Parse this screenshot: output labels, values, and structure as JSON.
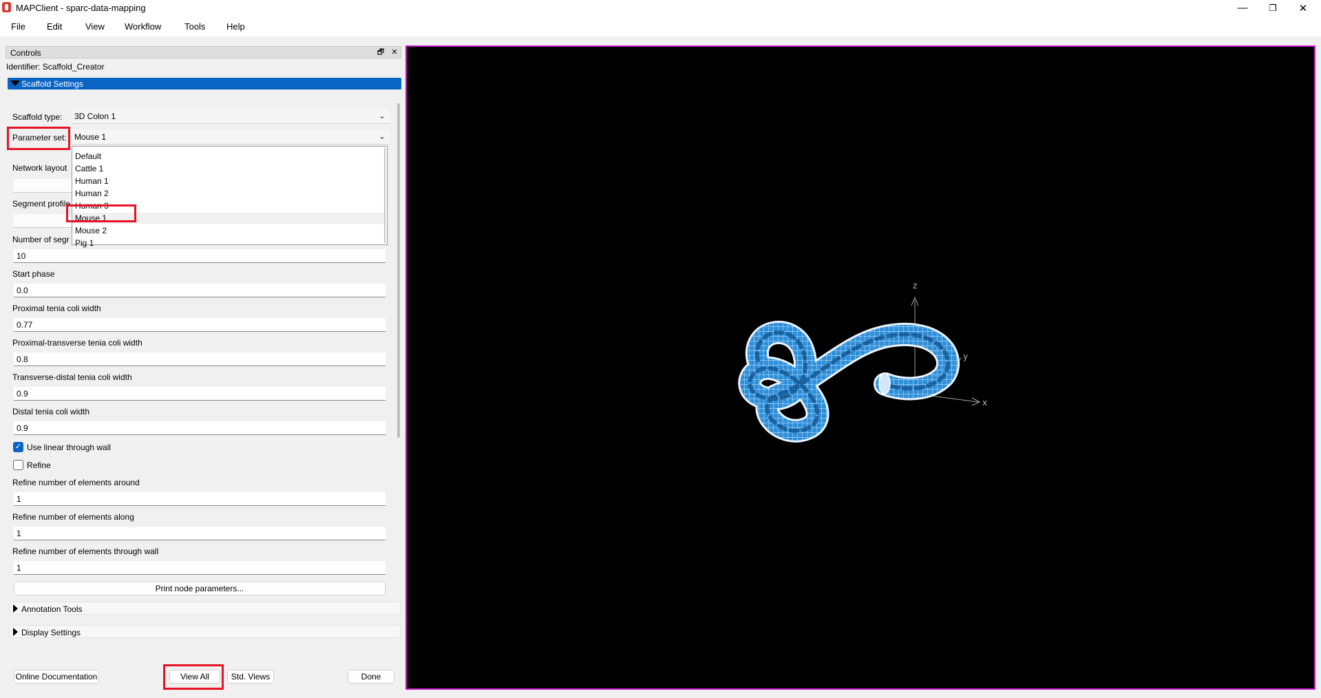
{
  "window": {
    "title": "MAPClient - sparc-data-mapping",
    "controls": {
      "minimize": "—",
      "restore": "❐",
      "close": "✕"
    }
  },
  "menubar": [
    "File",
    "Edit",
    "View",
    "Workflow",
    "Tools",
    "Help"
  ],
  "dock": {
    "title": "Controls",
    "float_icon": "🗗",
    "close_icon": "✕",
    "identifier": "Identifier:  Scaffold_Creator"
  },
  "scaffold_settings": {
    "header": "Scaffold Settings",
    "scaffold_type_label": "Scaffold type:",
    "scaffold_type_value": "3D Colon 1",
    "parameter_set_label": "Parameter set:",
    "parameter_set_value": "Mouse 1",
    "network_layout_label": "Network layout",
    "segment_profile_label": "Segment profile",
    "number_segments_label": "Number of segr",
    "number_segments_value": "10",
    "start_phase_label": "Start phase",
    "start_phase_value": "0.0",
    "proximal_label": "Proximal tenia coli width",
    "proximal_value": "0.77",
    "prox_trans_label": "Proximal-transverse tenia coli width",
    "prox_trans_value": "0.8",
    "trans_dist_label": "Transverse-distal tenia coli width",
    "trans_dist_value": "0.9",
    "distal_label": "Distal tenia coli width",
    "distal_value": "0.9",
    "linear_label": "Use linear through wall",
    "linear_checked": true,
    "refine_label": "Refine",
    "refine_checked": false,
    "refine_around_label": "Refine number of elements around",
    "refine_around_value": "1",
    "refine_along_label": "Refine number of elements along",
    "refine_along_value": "1",
    "refine_wall_label": "Refine number of elements through wall",
    "refine_wall_value": "1",
    "print_button": "Print node parameters..."
  },
  "parameter_set_options": [
    "Default",
    "Cattle 1",
    "Human 1",
    "Human 2",
    "Human 3",
    "Mouse 1",
    "Mouse 2",
    "Pig 1"
  ],
  "annotation_tools": "Annotation Tools",
  "display_settings": "Display Settings",
  "bottom_buttons": {
    "online_docs": "Online Documentation",
    "view_all": "View All",
    "std_views": "Std. Views",
    "done": "Done"
  },
  "viewport": {
    "axes": {
      "x": "x",
      "y": "y",
      "z": "z"
    },
    "model_color": "#2f8fd8",
    "border_color": "#c51bc5"
  },
  "colors": {
    "accent": "#0a64c4",
    "highlight": "#e81123"
  }
}
